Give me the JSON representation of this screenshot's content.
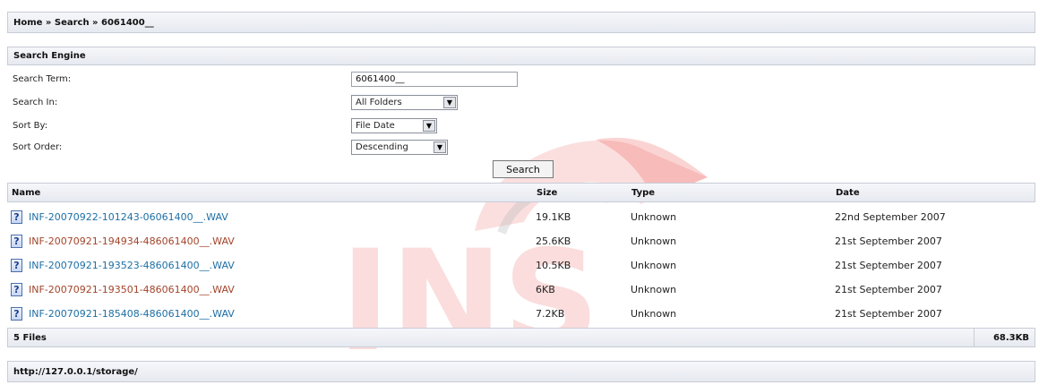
{
  "breadcrumb": {
    "text": "Home » Search » 6061400__"
  },
  "search_engine": {
    "title": "Search Engine",
    "term_label": "Search Term:",
    "term_value": "6061400__",
    "in_label": "Search In:",
    "in_value": "All Folders",
    "sort_label": "Sort By:",
    "sort_value": "File Date",
    "order_label": "Sort Order:",
    "order_value": "Descending",
    "search_button": "Search"
  },
  "table": {
    "headers": {
      "name": "Name",
      "size": "Size",
      "type": "Type",
      "date": "Date"
    },
    "rows": [
      {
        "name": "INF-20070922-101243-06061400__.WAV",
        "size": "19.1KB",
        "type": "Unknown",
        "date": "22nd September 2007"
      },
      {
        "name": "INF-20070921-194934-486061400__.WAV",
        "size": "25.6KB",
        "type": "Unknown",
        "date": "21st September 2007"
      },
      {
        "name": "INF-20070921-193523-486061400__.WAV",
        "size": "10.5KB",
        "type": "Unknown",
        "date": "21st September 2007"
      },
      {
        "name": "INF-20070921-193501-486061400__.WAV",
        "size": "6KB",
        "type": "Unknown",
        "date": "21st September 2007"
      },
      {
        "name": "INF-20070921-185408-486061400__.WAV",
        "size": "7.2KB",
        "type": "Unknown",
        "date": "21st September 2007"
      }
    ],
    "icon_glyph": "?"
  },
  "summary": {
    "count": "5 Files",
    "total": "68.3KB"
  },
  "footer": {
    "url": "http://127.0.0.1/storage/"
  },
  "watermark": {
    "text": "JNS",
    "color": "#e63b35"
  }
}
